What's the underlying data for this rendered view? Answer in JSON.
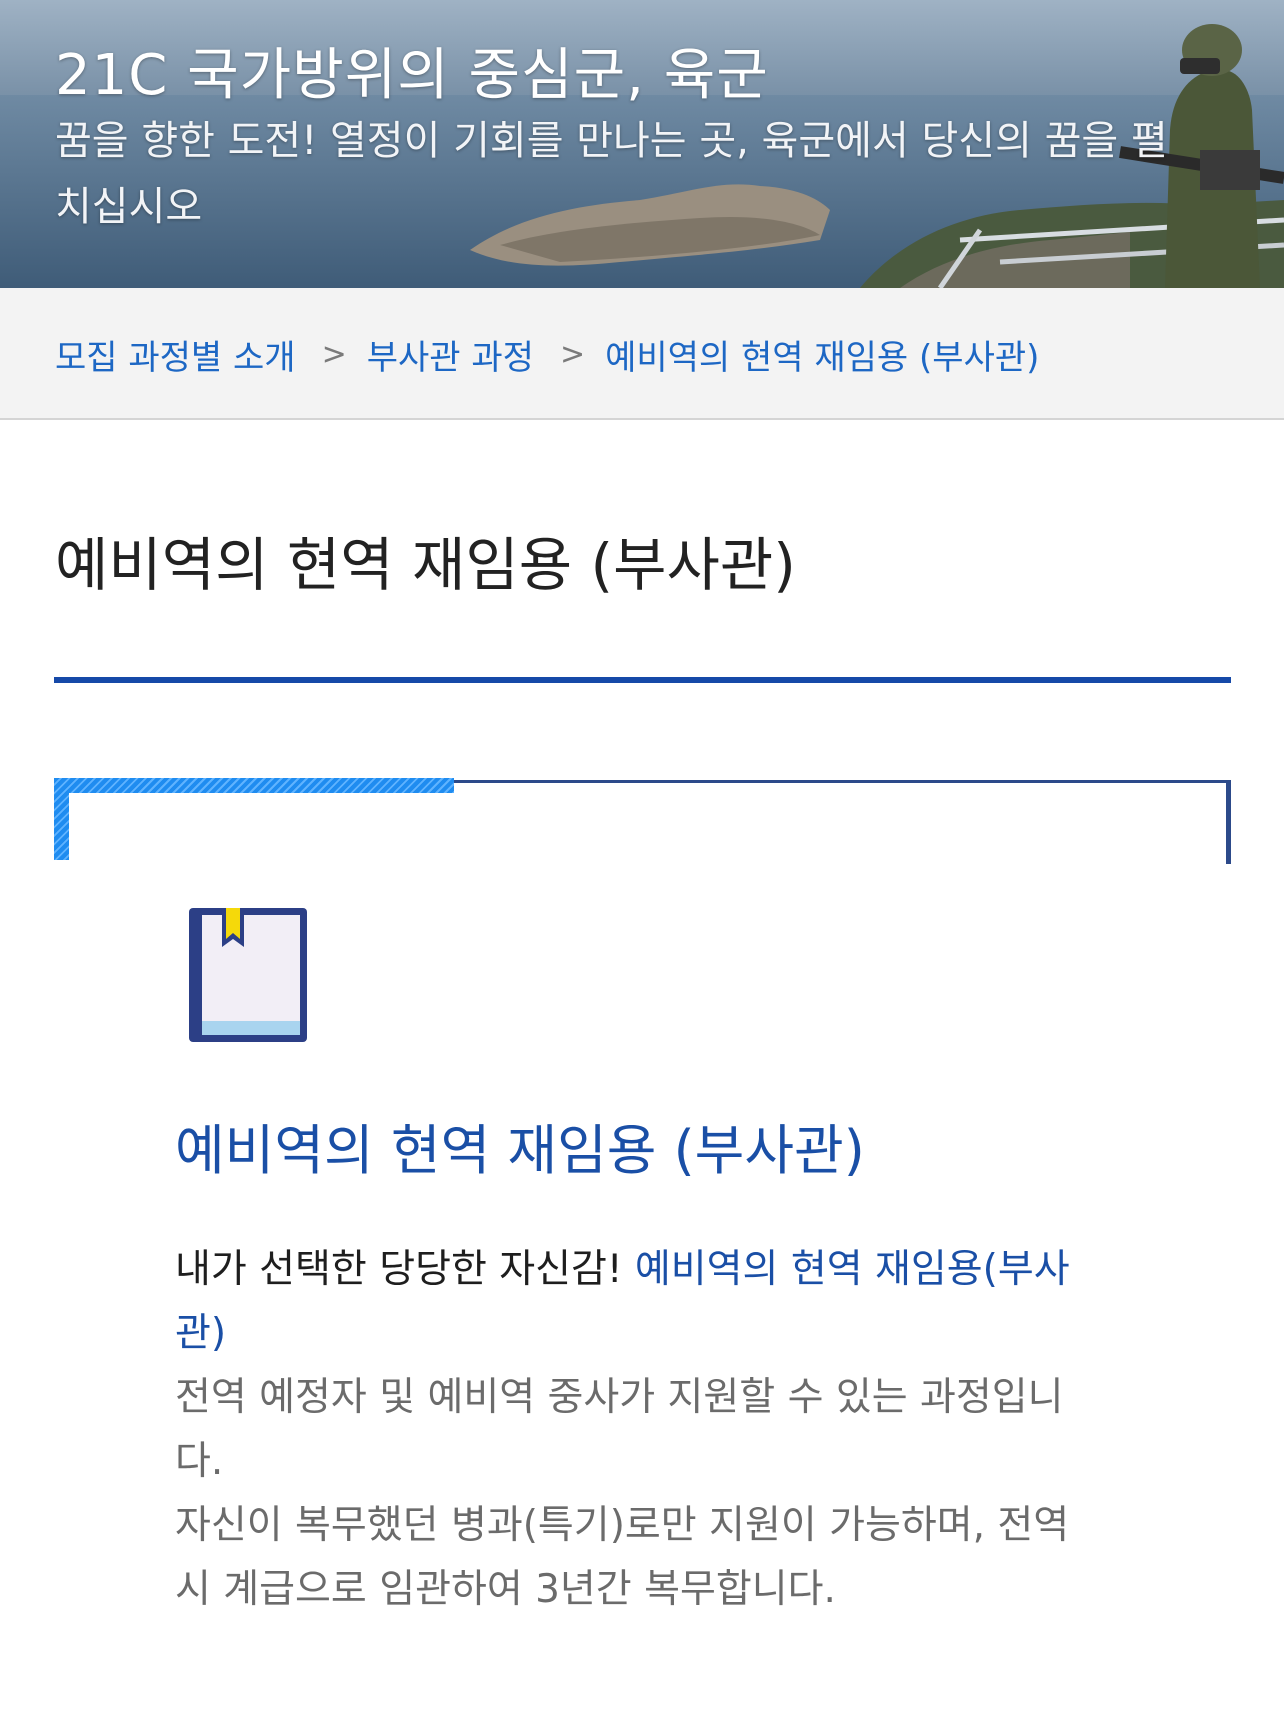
{
  "hero": {
    "title": "21C 국가방위의 중심군, 육군",
    "subtitle": "꿈을 향한 도전! 열정이 기회를 만나는 곳, 육군에서 당신의 꿈을 펼치십시오"
  },
  "breadcrumb": {
    "items": [
      "모집 과정별 소개",
      "부사관 과정",
      "예비역의 현역 재임용 (부사관)"
    ],
    "separator": ">"
  },
  "page": {
    "title": "예비역의 현역 재임용 (부사관)"
  },
  "card": {
    "icon": "book-icon",
    "title": "예비역의 현역 재임용 (부사관)",
    "lead": "내가 선택한 당당한 자신감! ",
    "highlight": "예비역의 현역 재임용(부사관)",
    "line1": "전역 예정자 및 예비역 중사가 지원할 수 있는 과정입니다.",
    "line2": "자신이 복무했던 병과(특기)로만 지원이 가능하며, 전역시 계급으로 임관하여 3년간 복무합니다."
  },
  "colors": {
    "accent": "#1649a8",
    "link": "#1d67c4",
    "frame": "#2c4a8a",
    "stripe": "#1f8cf0"
  }
}
